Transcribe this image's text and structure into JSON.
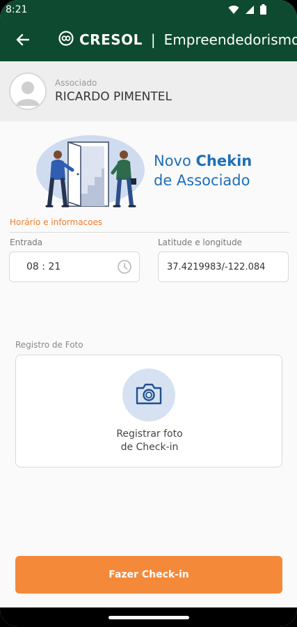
{
  "status_bar": {
    "time": "8:21",
    "icons": [
      "wifi-icon",
      "cell-signal-icon",
      "battery-icon"
    ]
  },
  "app_bar": {
    "back_icon": "arrow-left-icon",
    "brand_logo_icon": "cresol-logo-icon",
    "brand_name": "CRESOL",
    "separator": "|",
    "section_title": "Empreendedorismo",
    "colors": {
      "background": "#0e4a2f",
      "text": "#ffffff"
    }
  },
  "user": {
    "role_label": "Associado",
    "name": "RICARDO PIMENTEL",
    "avatar_icon": "user-avatar-icon"
  },
  "hero": {
    "title_line1_regular": "Novo ",
    "title_line1_bold": "Chekin",
    "title_line2": "de Associado",
    "color": "#1d6fb8"
  },
  "form": {
    "section_title": "Horário e informacoes",
    "section_color": "#f07d2c",
    "entrada": {
      "label": "Entrada",
      "value": "08 : 21",
      "icon": "clock-icon"
    },
    "location": {
      "label": "Latitude e longitude",
      "value": "37.4219983/-122.084"
    }
  },
  "photo": {
    "label": "Registro de Foto",
    "icon": "camera-icon",
    "line1": "Registrar foto",
    "line2": "de Check-in"
  },
  "action": {
    "checkin_label": "Fazer Check-in",
    "color": "#f5893a"
  }
}
